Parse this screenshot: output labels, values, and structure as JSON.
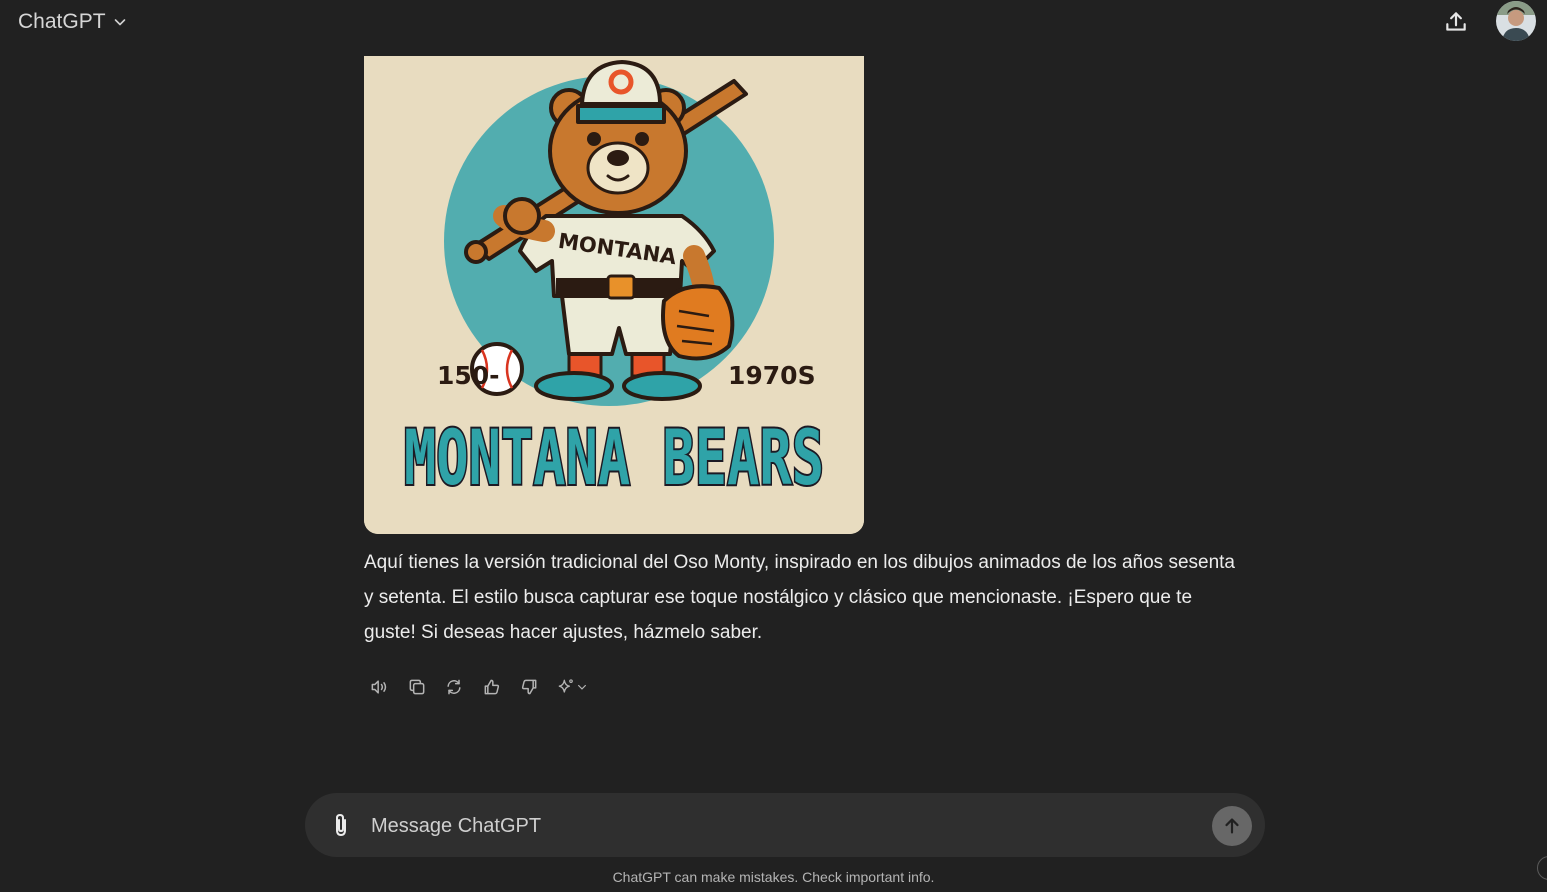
{
  "header": {
    "model_name": "ChatGPT",
    "icons": [
      "chevron-down-icon",
      "share-icon"
    ],
    "avatar": "user-avatar"
  },
  "image": {
    "left_text": "150-",
    "right_text": "1970S",
    "jersey_text": "MONTANA",
    "title_text": "MONTANA BEARS",
    "colors": {
      "background": "#e8dcc0",
      "circle": "#52adaf",
      "fur": "#c8782e",
      "teal": "#2fa3a8"
    }
  },
  "message": {
    "text": "Aquí tienes la versión tradicional del Oso Monty, inspirado en los dibujos animados de los años sesenta y setenta. El estilo busca capturar ese toque nostálgico y clásico que mencionaste. ¡Espero que te guste! Si deseas hacer ajustes, házmelo saber."
  },
  "actions": [
    "read-aloud-icon",
    "copy-icon",
    "regenerate-icon",
    "thumbs-up-icon",
    "thumbs-down-icon",
    "sparkle-icon"
  ],
  "composer": {
    "placeholder": "Message ChatGPT",
    "icons": [
      "paperclip-icon",
      "arrow-up-icon"
    ]
  },
  "footer": {
    "disclaimer": "ChatGPT can make mistakes. Check important info."
  },
  "colors": {
    "background": "#212121",
    "composer": "#2f2f2f",
    "send_button": "#676767"
  }
}
